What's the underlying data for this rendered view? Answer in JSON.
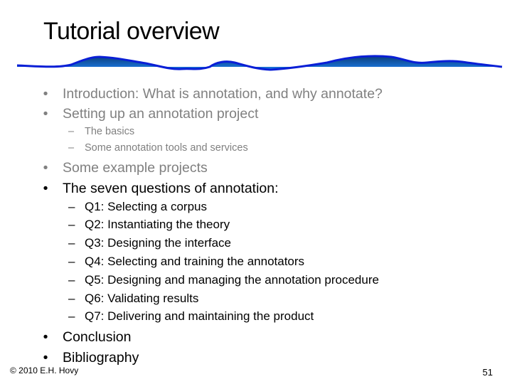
{
  "slide": {
    "title": "Tutorial overview",
    "decoration": "blue-wave-divider",
    "colors": {
      "wave_stroke": "#0a1fd6",
      "wave_fill_top": "#0b4a8a",
      "wave_fill_bottom": "#1a73e8",
      "dimmed_text": "#808080",
      "active_text": "#000000"
    }
  },
  "outline": [
    {
      "marker": "•",
      "text": "Introduction: What is annotation, and why annotate?",
      "state": "dimmed"
    },
    {
      "marker": "•",
      "text": "Setting up an annotation project",
      "state": "dimmed",
      "children": [
        {
          "marker": "–",
          "text": "The basics",
          "state": "dimmed"
        },
        {
          "marker": "–",
          "text": "Some annotation tools and services",
          "state": "dimmed"
        }
      ]
    },
    {
      "marker": "•",
      "text": "Some example projects",
      "state": "dimmed"
    },
    {
      "marker": "•",
      "text": "The seven questions of annotation:",
      "state": "active",
      "children": [
        {
          "marker": "–",
          "text": "Q1: Selecting a corpus",
          "state": "active"
        },
        {
          "marker": "–",
          "text": "Q2: Instantiating the theory",
          "state": "active"
        },
        {
          "marker": "–",
          "text": "Q3: Designing the interface",
          "state": "active"
        },
        {
          "marker": "–",
          "text": "Q4: Selecting and training the annotators",
          "state": "active"
        },
        {
          "marker": "–",
          "text": "Q5: Designing and managing the annotation procedure",
          "state": "active"
        },
        {
          "marker": "–",
          "text": "Q6: Validating results",
          "state": "active"
        },
        {
          "marker": "–",
          "text": "Q7: Delivering and maintaining the product",
          "state": "active"
        }
      ]
    },
    {
      "marker": "•",
      "text": "Conclusion",
      "state": "active"
    },
    {
      "marker": "•",
      "text": "Bibliography",
      "state": "active"
    }
  ],
  "footer": {
    "copyright": "© 2010  E.H. Hovy",
    "page_number": "51"
  }
}
